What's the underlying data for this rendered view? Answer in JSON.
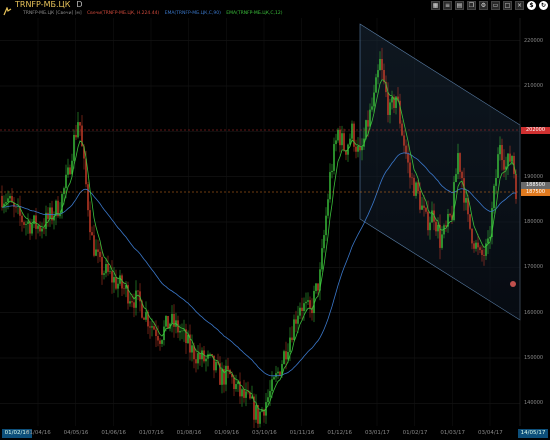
{
  "header": {
    "symbol": "TRNFP-МБ.ЦК",
    "timeframe": "D",
    "legend": [
      {
        "text": "TRNFP-МБ.ЦК [Свечи] [м]",
        "color": "#8c8c8c"
      },
      {
        "text": "Свечи(TRNFP-МБ.ЦК, H.224.44)",
        "color": "#d24a3c"
      },
      {
        "text": "EMA(TRNFP-МБ.ЦК,C,90)",
        "color": "#3a77c9"
      },
      {
        "text": "EMA(TRNFP-МБ.ЦК,C,12)",
        "color": "#3bbf3b"
      }
    ]
  },
  "toolbar_icons": [
    "grid-icon",
    "list-icon",
    "layout-icon",
    "copy-icon",
    "settings-icon",
    "window-icon",
    "maximize-icon",
    "close-icon",
    "dollar-icon",
    "refresh-icon"
  ],
  "price_tags": [
    {
      "value": "202000",
      "color": "#d03030"
    },
    {
      "value": "188500",
      "color": "#b0b0b0"
    },
    {
      "value": "187500",
      "color": "#e07a1f"
    }
  ],
  "x_axis": {
    "left_tag": "01/02/16",
    "right_tag": "14/05/17",
    "labels": [
      "01/04/16",
      "04/05/16",
      "01/06/16",
      "01/07/16",
      "01/08/16",
      "01/09/16",
      "03/10/16",
      "01/11/16",
      "01/12/16",
      "03/01/17",
      "01/02/17",
      "01/03/17",
      "03/04/17"
    ]
  },
  "y_axis": {
    "labels": [
      "220000",
      "210000",
      "200000",
      "190000",
      "180000",
      "170000",
      "160000",
      "150000",
      "140000"
    ]
  },
  "chart_data": {
    "type": "candlestick",
    "ylim": [
      135000,
      225000
    ],
    "levels": {
      "resistance": 202000,
      "current": 187500
    },
    "close_series": [
      [
        0,
        186000
      ],
      [
        8,
        185000
      ],
      [
        15,
        182000
      ],
      [
        25,
        180000
      ],
      [
        40,
        179000
      ],
      [
        50,
        181000
      ],
      [
        60,
        184000
      ],
      [
        68,
        190000
      ],
      [
        72,
        196000
      ],
      [
        76,
        200000
      ],
      [
        79,
        204000
      ],
      [
        82,
        196000
      ],
      [
        86,
        188000
      ],
      [
        92,
        176000
      ],
      [
        100,
        170000
      ],
      [
        110,
        168000
      ],
      [
        120,
        166000
      ],
      [
        130,
        164000
      ],
      [
        140,
        162000
      ],
      [
        150,
        158000
      ],
      [
        160,
        155000
      ],
      [
        170,
        158000
      ],
      [
        180,
        156000
      ],
      [
        190,
        152000
      ],
      [
        200,
        150000
      ],
      [
        210,
        149000
      ],
      [
        220,
        146000
      ],
      [
        230,
        146000
      ],
      [
        240,
        142000
      ],
      [
        250,
        140000
      ],
      [
        258,
        137000
      ],
      [
        265,
        140000
      ],
      [
        272,
        143000
      ],
      [
        280,
        148000
      ],
      [
        290,
        155000
      ],
      [
        300,
        162000
      ],
      [
        310,
        160000
      ],
      [
        320,
        168000
      ],
      [
        330,
        190000
      ],
      [
        338,
        200000
      ],
      [
        345,
        196000
      ],
      [
        352,
        200000
      ],
      [
        360,
        194000
      ],
      [
        368,
        202000
      ],
      [
        374,
        207000
      ],
      [
        380,
        215000
      ],
      [
        384,
        210000
      ],
      [
        390,
        204000
      ],
      [
        396,
        208000
      ],
      [
        402,
        200000
      ],
      [
        410,
        190000
      ],
      [
        418,
        186000
      ],
      [
        426,
        180000
      ],
      [
        434,
        182000
      ],
      [
        440,
        176000
      ],
      [
        446,
        178000
      ],
      [
        452,
        182000
      ],
      [
        458,
        195000
      ],
      [
        462,
        190000
      ],
      [
        468,
        180000
      ],
      [
        474,
        176000
      ],
      [
        480,
        172000
      ],
      [
        488,
        174000
      ],
      [
        494,
        186000
      ],
      [
        500,
        198000
      ],
      [
        506,
        192000
      ],
      [
        512,
        195000
      ],
      [
        516,
        187500
      ]
    ]
  }
}
